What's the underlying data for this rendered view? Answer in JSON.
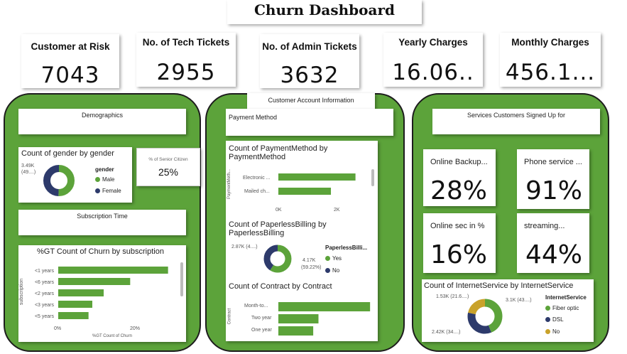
{
  "title": "Churn Dashboard",
  "kpis": [
    {
      "title": "Customer at Risk",
      "value": "7043"
    },
    {
      "title": "No. of Tech Tickets",
      "value": "2955"
    },
    {
      "title": "No. of Admin Tickets",
      "value": "3632"
    },
    {
      "title": "Yearly Charges",
      "value": "16.06.."
    },
    {
      "title": "Monthly Charges",
      "value": "456.1..."
    }
  ],
  "left_panel": {
    "demographics_label": "Demographics",
    "gender_chart": {
      "title": "Count of gender by gender",
      "data_label": "3.49K (49....)",
      "legend_title": "gender",
      "legend": [
        "Male",
        "Female"
      ]
    },
    "senior": {
      "label": "% of Senior Citizen",
      "value": "25%"
    },
    "subscription_label": "Subscription Time",
    "subscription_chart": {
      "title": "%GT Count of Churn by subscription",
      "ylabel": "subscription",
      "xlabel": "%GT Count of Churn",
      "x_ticks": [
        "0%",
        "20%"
      ]
    }
  },
  "middle_panel": {
    "header": "Customer Account Information",
    "payment_label": "Payment Method",
    "payment_chart": {
      "title": "Count of PaymentMethod by PaymentMethod",
      "ylabel": "PaymentMeth...",
      "x_ticks": [
        "0K",
        "2K"
      ],
      "category_labels": [
        "Electronic ...",
        "Mailed ch..."
      ]
    },
    "paperless_chart": {
      "title": "Count of PaperlessBilling by PaperlessBilling",
      "left_label": "2.87K (4....)",
      "right_label_1": "4.17K",
      "right_label_2": "(59.22%)",
      "legend_title": "PaperlessBilli...",
      "legend": [
        "Yes",
        "No"
      ]
    },
    "contract_chart": {
      "title": "Count of Contract by Contract",
      "ylabel": "Contract",
      "category_labels": [
        "Month-to...",
        "Two year",
        "One year"
      ]
    }
  },
  "right_panel": {
    "header": "Services Customers Signed Up for",
    "services": [
      {
        "title": "Online Backup...",
        "value": "28%"
      },
      {
        "title": "Phone service ...",
        "value": "91%"
      },
      {
        "title": "Online sec in %",
        "value": "16%"
      },
      {
        "title": "streaming...",
        "value": "44%"
      }
    ],
    "internet_chart": {
      "title": "Count of InternetService by InternetService",
      "label_top_left": "1.53K (21.6....)",
      "label_top_right": "3.1K (43....)",
      "label_bottom": "2.42K (34....)",
      "legend_title": "InternetService",
      "legend": [
        "Fiber optic",
        "DSL",
        "No"
      ]
    }
  },
  "colors": {
    "panel_green": "#5ca33a",
    "bar_green": "#5ca33a",
    "navy": "#2d3a6b",
    "gold": "#c9a22a"
  },
  "chart_data": [
    {
      "type": "pie",
      "title": "Count of gender by gender",
      "categories": [
        "Male",
        "Female"
      ],
      "values": [
        3550,
        3490
      ]
    },
    {
      "type": "bar",
      "title": "%GT Count of Churn by subscription",
      "categories": [
        "<1 years",
        "<6 years",
        "<2 years",
        "<3 years",
        "<5 years"
      ],
      "values": [
        29,
        19,
        12,
        9,
        8
      ],
      "xlabel": "%GT Count of Churn",
      "ylabel": "subscription",
      "xlim": [
        0,
        30
      ]
    },
    {
      "type": "bar",
      "title": "Count of PaymentMethod by PaymentMethod",
      "categories": [
        "Electronic ...",
        "Mailed ch..."
      ],
      "values": [
        2365,
        1612
      ],
      "xlim": [
        0,
        2700
      ]
    },
    {
      "type": "pie",
      "title": "Count of PaperlessBilling by PaperlessBilling",
      "categories": [
        "Yes",
        "No"
      ],
      "values": [
        4170,
        2870
      ]
    },
    {
      "type": "bar",
      "title": "Count of Contract by Contract",
      "categories": [
        "Month-to...",
        "Two year",
        "One year"
      ],
      "values": [
        3875,
        1695,
        1473
      ],
      "xlim": [
        0,
        3900
      ]
    },
    {
      "type": "pie",
      "title": "Count of InternetService by InternetService",
      "categories": [
        "Fiber optic",
        "DSL",
        "No"
      ],
      "values": [
        3100,
        2420,
        1530
      ]
    }
  ]
}
